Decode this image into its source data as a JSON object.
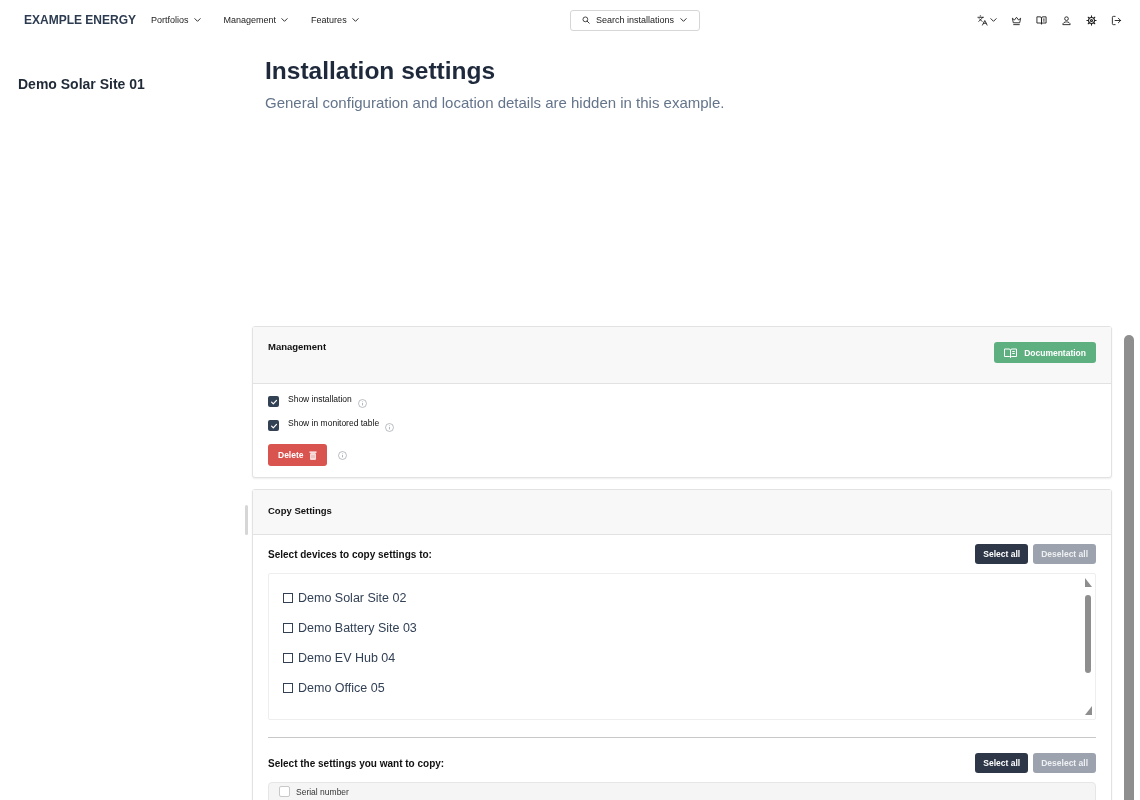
{
  "header": {
    "logo": "EXAMPLE ENERGY",
    "nav": [
      "Portfolios",
      "Management",
      "Features"
    ],
    "search": {
      "label": "Search installations"
    }
  },
  "sidebar": {
    "title": "Demo Solar Site 01"
  },
  "page": {
    "title": "Installation settings",
    "subtitle": "General configuration and location details are hidden in this example."
  },
  "management": {
    "title": "Management",
    "documentation_button": "Documentation",
    "options": [
      {
        "label": "Show installation",
        "checked": true
      },
      {
        "label": "Show in monitored table",
        "checked": true
      }
    ],
    "delete_button": "Delete"
  },
  "copy_settings": {
    "title": "Copy Settings",
    "devices": {
      "heading": "Select devices to copy settings to:",
      "buttons": [
        {
          "label": "Select all",
          "disabled": false
        },
        {
          "label": "Deselect all",
          "disabled": true
        }
      ],
      "items": [
        {
          "label": "Demo Solar Site 02",
          "checked": false
        },
        {
          "label": "Demo Battery Site 03",
          "checked": false
        },
        {
          "label": "Demo EV Hub 04",
          "checked": false
        },
        {
          "label": "Demo Office 05",
          "checked": false
        }
      ]
    },
    "settings": {
      "heading": "Select the settings you want to copy:",
      "buttons": [
        {
          "label": "Select all",
          "disabled": false
        },
        {
          "label": "Deselect all",
          "disabled": true
        }
      ],
      "items": [
        {
          "label": "Serial number",
          "checked": false
        }
      ]
    }
  }
}
